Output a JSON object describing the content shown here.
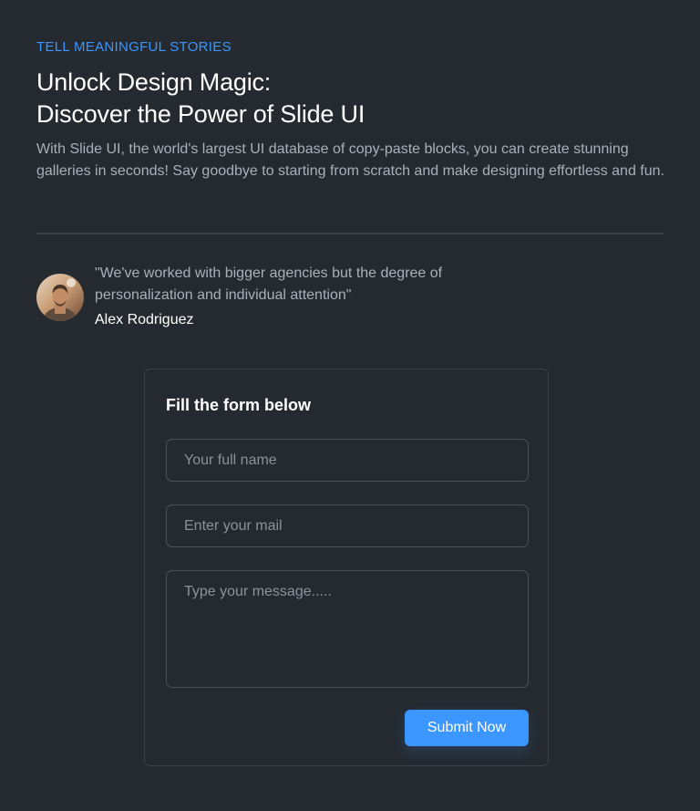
{
  "hero": {
    "eyebrow": "TELL MEANINGFUL STORIES",
    "title_line1": "Unlock Design Magic:",
    "title_line2": "Discover the Power of Slide UI",
    "description": "With Slide UI, the world's largest UI database of copy-paste blocks, you can create stunning galleries in seconds! Say goodbye to starting from scratch and make designing effortless and fun."
  },
  "testimonial": {
    "quote": "\"We've worked with bigger agencies but the degree of personalization and individual attention\"",
    "author": "Alex Rodriguez"
  },
  "form": {
    "title": "Fill the form below",
    "name_placeholder": "Your full name",
    "email_placeholder": "Enter your mail",
    "message_placeholder": "Type your message.....",
    "submit_label": "Submit Now"
  },
  "colors": {
    "background": "#252a31",
    "accent": "#3b97ff",
    "heading": "#ffffff",
    "body_text": "#a9b0b9",
    "border": "#4a515b"
  }
}
